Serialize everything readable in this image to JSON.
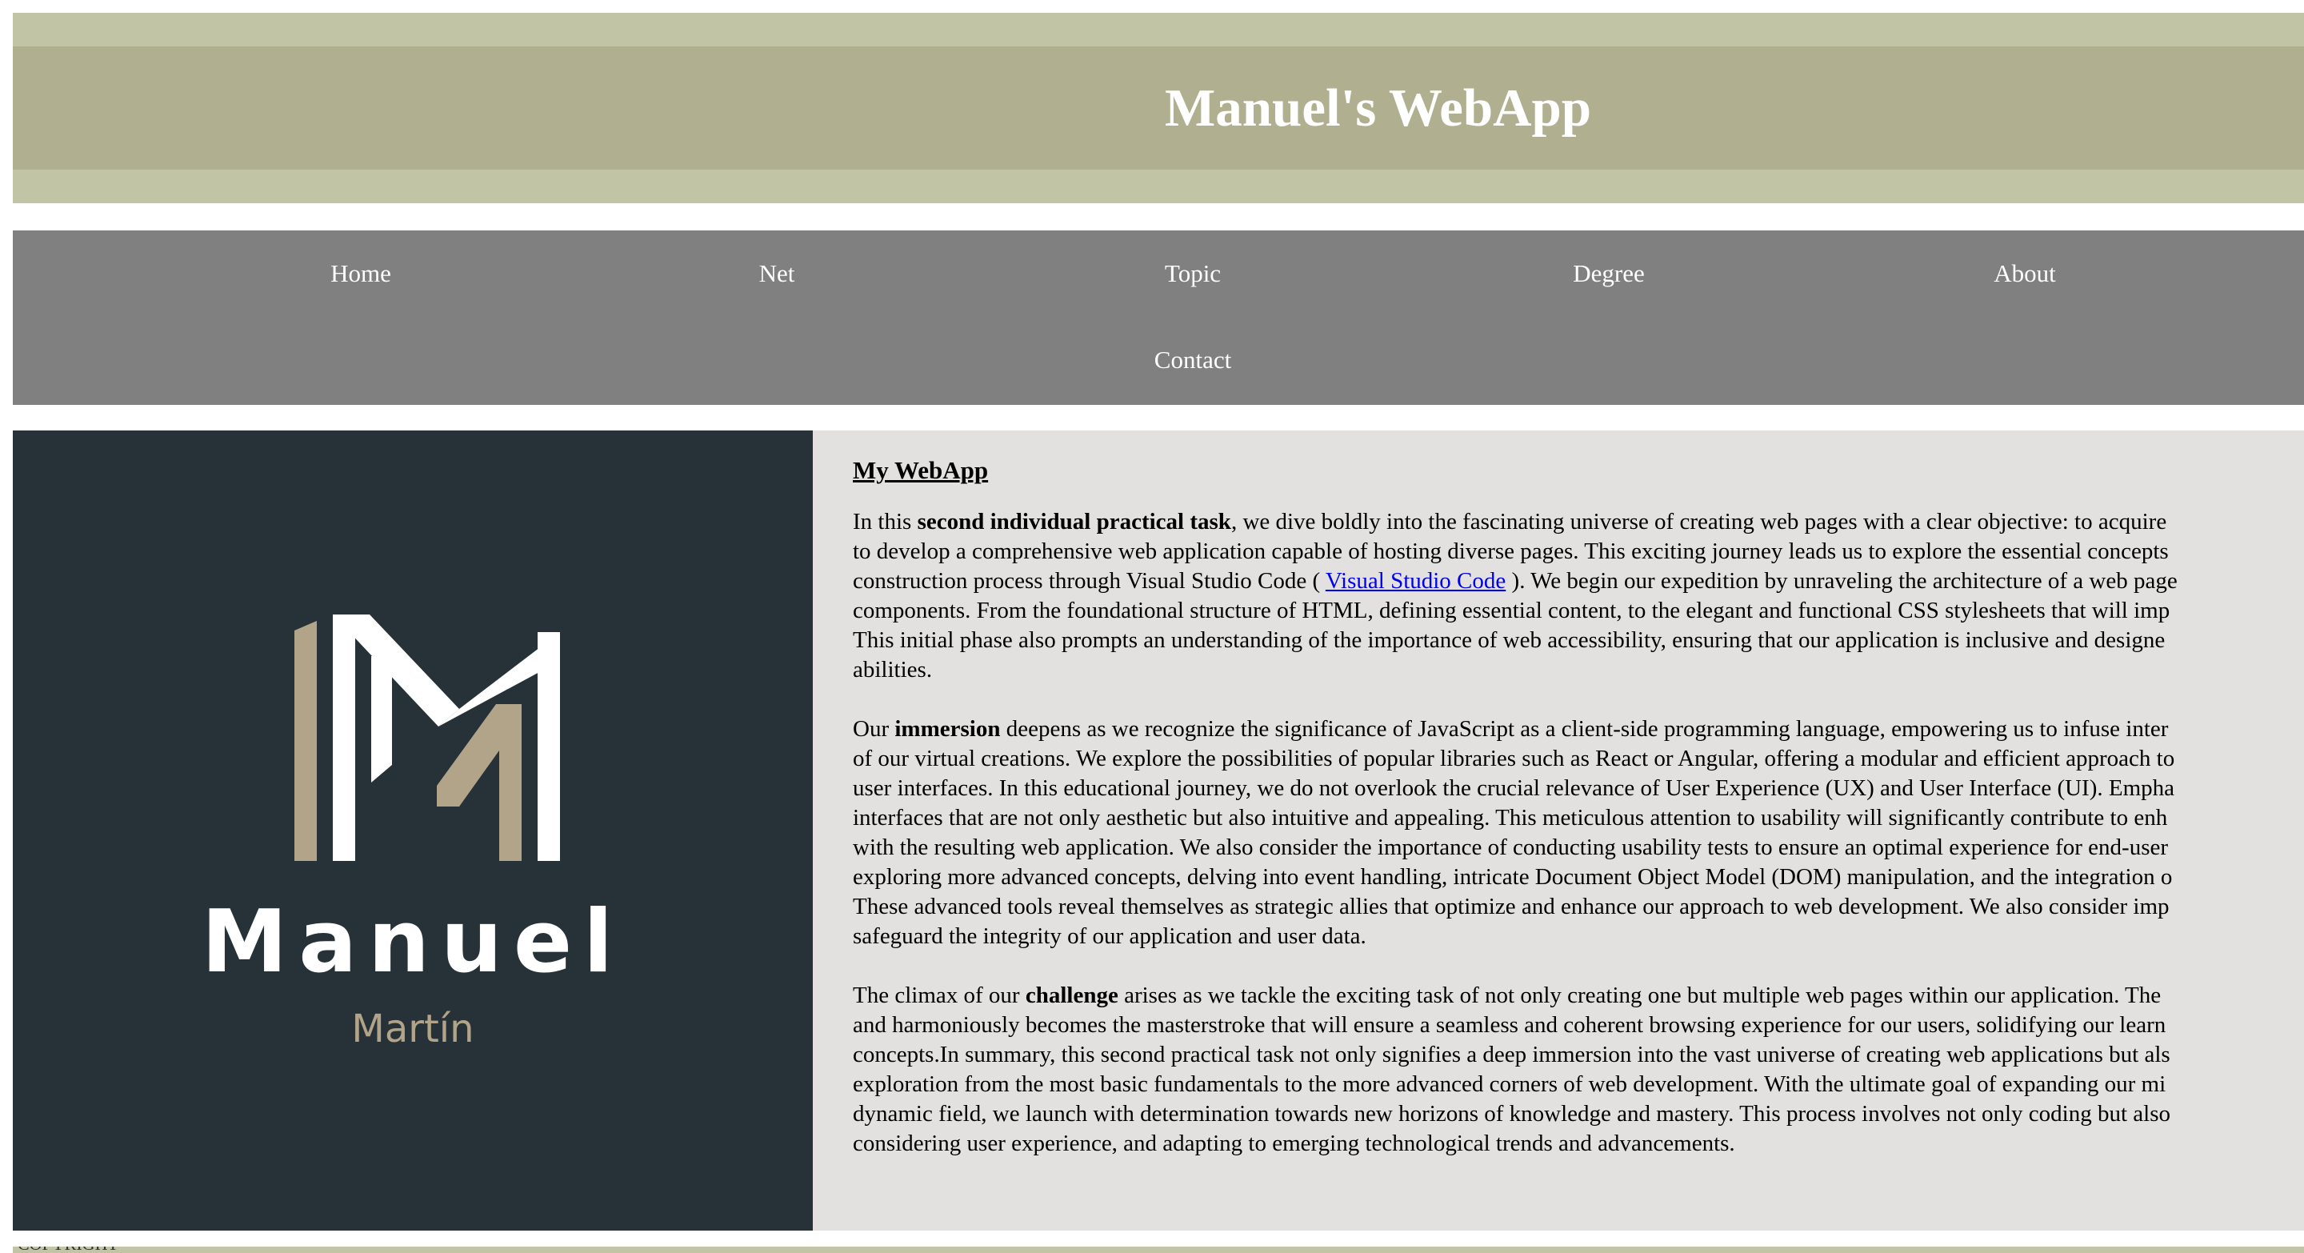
{
  "header": {
    "title": "Manuel's WebApp"
  },
  "nav": {
    "items": [
      {
        "label": "Home"
      },
      {
        "label": "Net"
      },
      {
        "label": "Topic"
      },
      {
        "label": "Degree"
      },
      {
        "label": "About"
      },
      {
        "label": "Contact"
      }
    ]
  },
  "logo": {
    "name": "Manuel",
    "surname": "Martín",
    "colors": {
      "background": "#263238",
      "white": "#ffffff",
      "accent": "#b2a489"
    }
  },
  "content": {
    "title": "My WebApp",
    "p1": {
      "t1": "In this ",
      "b1": "second individual practical task",
      "t2": ", we dive boldly into the fascinating universe of creating web pages with a clear objective: to acquire",
      "t3": "to develop a comprehensive web application capable of hosting diverse pages. This exciting journey leads us to explore the essential concepts",
      "t4": "construction process through Visual Studio Code ( ",
      "link": "Visual Studio Code",
      "t5": " ). We begin our expedition by unraveling the architecture of a web page",
      "t6": "components. From the foundational structure of HTML, defining essential content, to the elegant and functional CSS stylesheets that will imp",
      "t7": "This initial phase also prompts an understanding of the importance of web accessibility, ensuring that our application is inclusive and designe",
      "t8": "abilities."
    },
    "p2": {
      "t1": "Our ",
      "b1": "immersion",
      "t2": " deepens as we recognize the significance of JavaScript as a client-side programming language, empowering us to infuse inter",
      "t3": "of our virtual creations. We explore the possibilities of popular libraries such as React or Angular, offering a modular and efficient approach to",
      "t4": "user interfaces. In this educational journey, we do not overlook the crucial relevance of User Experience (UX) and User Interface (UI). Empha",
      "t5": "interfaces that are not only aesthetic but also intuitive and appealing. This meticulous attention to usability will significantly contribute to enh",
      "t6": "with the resulting web application. We also consider the importance of conducting usability tests to ensure an optimal experience for end-user",
      "t7": "exploring more advanced concepts, delving into event handling, intricate Document Object Model (DOM) manipulation, and the integration o",
      "t8": "These advanced tools reveal themselves as strategic allies that optimize and enhance our approach to web development. We also consider imp",
      "t9": "safeguard the integrity of our application and user data."
    },
    "p3": {
      "t1": "The climax of our ",
      "b1": "challenge",
      "t2": " arises as we tackle the exciting task of not only creating one but multiple web pages within our application. The",
      "t3": "and harmoniously becomes the masterstroke that will ensure a seamless and coherent browsing experience for our users, solidifying our learn",
      "t4": "concepts.In summary, this second practical task not only signifies a deep immersion into the vast universe of creating web applications but als",
      "t5": "exploration from the most basic fundamentals to the more advanced corners of web development. With the ultimate goal of expanding our mi",
      "t6": "dynamic field, we launch with determination towards new horizons of knowledge and mastery. This process involves not only coding but also",
      "t7": "considering user experience, and adapting to emerging technological trends and advancements."
    }
  },
  "footer": {
    "text": "COPYRIGHT"
  },
  "colors": {
    "header_outer": "#c2c4a6",
    "header_band": "#b0b090",
    "nav_bg": "#808080",
    "content_bg": "#e2e1df",
    "link": "#0000ee"
  }
}
